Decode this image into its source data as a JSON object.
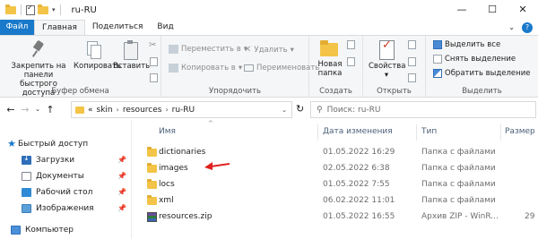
{
  "window": {
    "title": "ru-RU",
    "controls": {
      "minimize": "—",
      "maximize": "☐",
      "close": "✕"
    }
  },
  "ribbon": {
    "tabs": [
      "Файл",
      "Главная",
      "Поделиться",
      "Вид"
    ],
    "active_tab": "Главная",
    "groups": {
      "clipboard": {
        "label": "Буфер обмена",
        "pin_line1": "Закрепить на панели",
        "pin_line2": "быстрого доступа",
        "copy": "Копировать",
        "paste": "Вставить"
      },
      "organize": {
        "label": "Упорядочить",
        "move_to": "Переместить в",
        "copy_to": "Копировать в",
        "delete": "Удалить",
        "rename": "Переименовать"
      },
      "create": {
        "label": "Создать",
        "new_folder_line1": "Новая",
        "new_folder_line2": "папка"
      },
      "open": {
        "label": "Открыть",
        "properties": "Свойства"
      },
      "select": {
        "label": "Выделить",
        "select_all": "Выделить все",
        "select_none": "Снять выделение",
        "invert": "Обратить выделение"
      }
    }
  },
  "address": {
    "crumbs": [
      "skin",
      "resources",
      "ru-RU"
    ],
    "overflow": "«",
    "search_placeholder": "Поиск: ru-RU"
  },
  "nav_pane": {
    "quick_access": "Быстрый доступ",
    "items": [
      "Загрузки",
      "Документы",
      "Рабочий стол",
      "Изображения"
    ],
    "computer": "Компьютер"
  },
  "file_list": {
    "columns": [
      "Имя",
      "Дата изменения",
      "Тип",
      "Размер"
    ],
    "rows": [
      {
        "name": "dictionaries",
        "date": "01.05.2022 16:29",
        "type": "Папка с файлами",
        "size": "",
        "kind": "folder"
      },
      {
        "name": "images",
        "date": "02.05.2022 6:38",
        "type": "Папка с файлами",
        "size": "",
        "kind": "folder"
      },
      {
        "name": "locs",
        "date": "01.05.2022 7:55",
        "type": "Папка с файлами",
        "size": "",
        "kind": "folder"
      },
      {
        "name": "xml",
        "date": "06.02.2022 11:01",
        "type": "Папка с файлами",
        "size": "",
        "kind": "folder"
      },
      {
        "name": "resources.zip",
        "date": "01.05.2022 16:55",
        "type": "Архив ZIP - WinR...",
        "size": "29",
        "kind": "zip"
      }
    ]
  },
  "colors": {
    "accent": "#1979ca",
    "folder": "#f3c447",
    "annotation_arrow": "#e02020"
  }
}
